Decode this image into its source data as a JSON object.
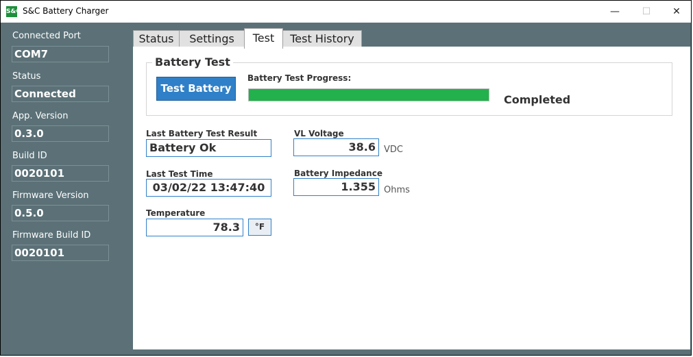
{
  "window": {
    "title": "S&C Battery Charger",
    "icon_text": "S&C",
    "minimize": "—",
    "maximize": "☐",
    "close": "✕"
  },
  "sidebar": {
    "connected_port": {
      "label": "Connected Port",
      "value": "COM7"
    },
    "status": {
      "label": "Status",
      "value": "Connected"
    },
    "app_version": {
      "label": "App. Version",
      "value": "0.3.0"
    },
    "build_id": {
      "label": "Build ID",
      "value": "0020101"
    },
    "firmware_version": {
      "label": "Firmware Version",
      "value": "0.5.0"
    },
    "firmware_build_id": {
      "label": "Firmware Build ID",
      "value": "0020101"
    }
  },
  "tabs": {
    "status": "Status",
    "settings": "Settings",
    "test": "Test",
    "test_history": "Test History",
    "active": "Test"
  },
  "battery_test": {
    "group_title": "Battery Test",
    "button_label": "Test Battery",
    "progress_label": "Battery Test Progress:",
    "progress_fraction": 1.0,
    "progress_status": "Completed"
  },
  "results": {
    "last_result": {
      "label": "Last Battery Test Result",
      "value": "Battery Ok"
    },
    "last_time": {
      "label": "Last Test Time",
      "value": "03/02/22 13:47:40"
    },
    "temperature": {
      "label": "Temperature",
      "value": "78.3",
      "unit_button": "°F"
    },
    "vl_voltage": {
      "label": "VL Voltage",
      "value": "38.6",
      "unit": "VDC"
    },
    "impedance": {
      "label": "Battery Impedance",
      "value": "1.355",
      "unit": "Ohms"
    }
  },
  "colors": {
    "panel_bg": "#5b7177",
    "accent_blue": "#2f80c8",
    "progress_green": "#22b14c"
  }
}
